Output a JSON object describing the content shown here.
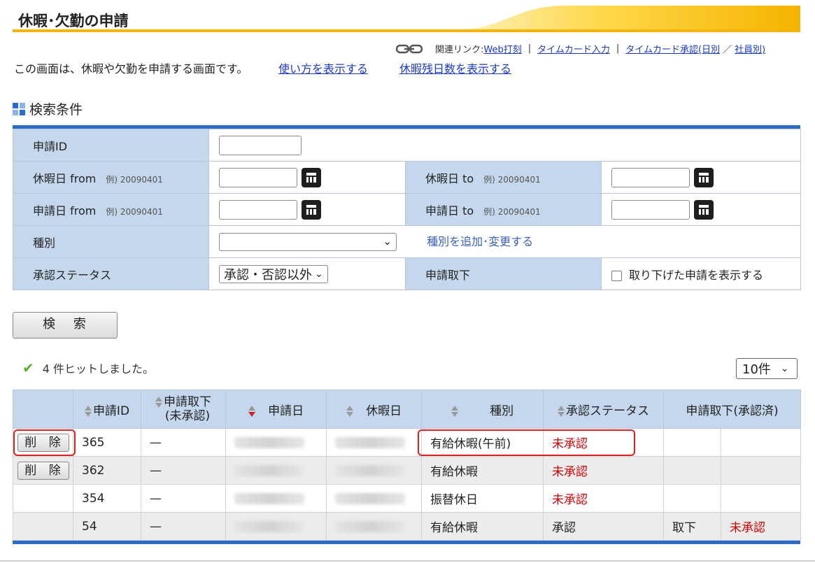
{
  "header": {
    "title": "休暇･欠勤の申請"
  },
  "related": {
    "label": "関連リンク:",
    "web_punch": "Web打刻",
    "timecard_input": "タイムカード入力",
    "timecard_approve_daily": "タイムカード承認(日別",
    "slash": "／",
    "by_employee": "社員別)",
    "sep": "|"
  },
  "intro": {
    "text": "この画面は、休暇や欠勤を申請する画面です。",
    "help_link": "使い方を表示する",
    "remain_link": "休暇残日数を表示する"
  },
  "search": {
    "heading": "検索条件",
    "labels": {
      "request_id": "申請ID",
      "leave_from": "休暇日 from",
      "leave_to": "休暇日 to",
      "req_from": "申請日 from",
      "req_to": "申請日 to",
      "type": "種別",
      "status": "承認ステータス",
      "withdraw": "申請取下"
    },
    "example": "例) 20090401",
    "type_link": "種別を追加･変更する",
    "status_value": "承認・否認以外",
    "withdraw_checkbox": "取り下げた申請を表示する",
    "button": "検 索"
  },
  "results": {
    "hit_text": "4 件ヒットしました。",
    "per_page": "10件",
    "headers": {
      "request_id": "申請ID",
      "withdraw_unapproved_1": "申請取下",
      "withdraw_unapproved_2": "(未承認)",
      "request_date": "申請日",
      "leave_date": "休暇日",
      "type": "種別",
      "status": "承認ステータス",
      "withdraw_approved": "申請取下(承認済)"
    },
    "delete_label": "削 除",
    "rows": [
      {
        "id": "365",
        "withdraw": "—",
        "type": "有給休暇(午前)",
        "status": "未承認",
        "w1": "",
        "w2": ""
      },
      {
        "id": "362",
        "withdraw": "—",
        "type": "有給休暇",
        "status": "未承認",
        "w1": "",
        "w2": ""
      },
      {
        "id": "354",
        "withdraw": "—",
        "type": "振替休日",
        "status": "未承認",
        "w1": "",
        "w2": ""
      },
      {
        "id": "54",
        "withdraw": "—",
        "type": "有給休暇",
        "status": "承認",
        "w1": "取下",
        "w2": "未承認"
      }
    ]
  },
  "colors": {
    "accent_blue": "#2b6cc8",
    "label_bg": "#c5d7ec",
    "title_gradient": "#f5b400",
    "status_red": "#cc0000",
    "highlight": "#e02020"
  }
}
